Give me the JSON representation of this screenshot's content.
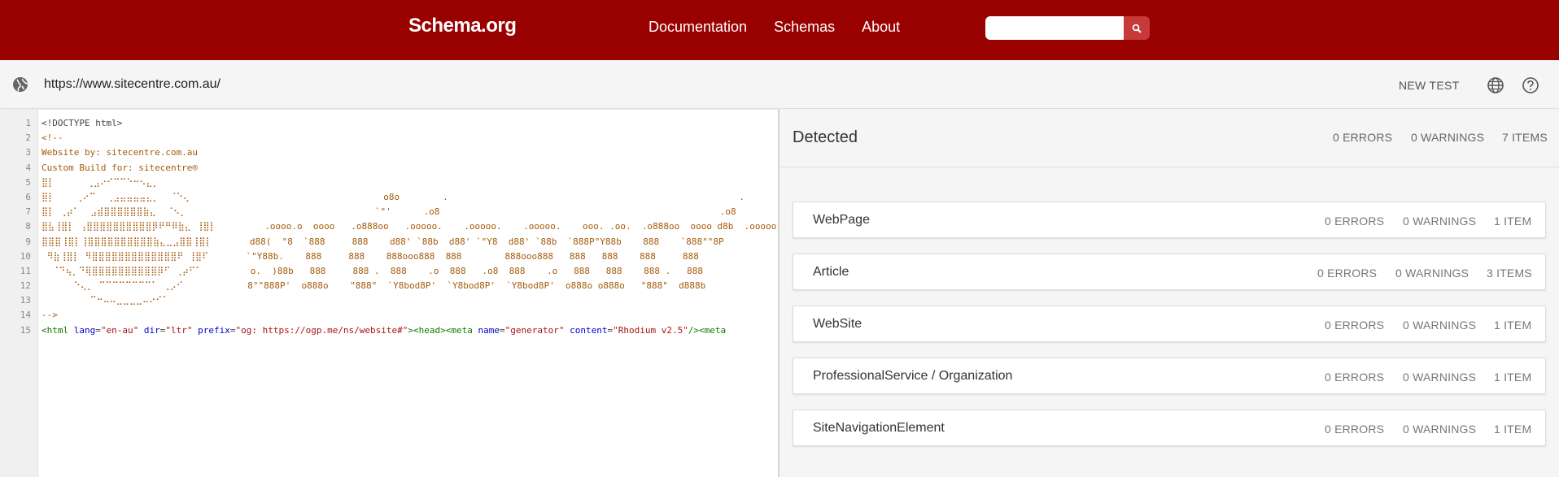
{
  "header": {
    "logo": "Schema.org",
    "nav": [
      "Documentation",
      "Schemas",
      "About"
    ],
    "search_placeholder": ""
  },
  "urlbar": {
    "url": "https://www.sitecentre.com.au/",
    "new_test": "NEW TEST"
  },
  "code": {
    "line_numbers": [
      "1",
      "2",
      "3",
      "4",
      "5",
      "6",
      "7",
      "8",
      "9",
      "10",
      "11",
      "12",
      "13",
      "14",
      "15"
    ],
    "lines": [
      "<!DOCTYPE html>",
      "<!--",
      "Website by: sitecentre.com.au",
      "Custom Build for: sitecentre®",
      "⣿⡇      ⢀⣠⠔⠊⠉⠉⠑⠒⠢⣄⡀",
      "⣿⡇    ⢀⠔⠉  ⢀⣠⣤⣤⣤⣤⣄⡀  ⠈⠑⢄                                    o8o        .                                                      .",
      "⣿⡇ ⢀⡴⠁  ⣠⣾⣿⣿⣿⣿⣿⣿⣷⣄  ⠈⠢⡀                                   `\"'      .o8                                                    .o8",
      "⣿⣧⢸⣿⡇ ⢠⣿⣿⣿⣿⣿⣿⣿⣿⣿⣿⡿⠟⠛⠿⣷⣄ ⢸⣿⡇         .oooo.o  oooo   .o888oo   .ooooo.    .ooooo.    .ooooo.    ooo. .oo.  .o888oo  oooo d8b  .ooooo.",
      "⣿⣿⣿⢸⣿⡇⢸⣿⣿⣿⣿⣿⣿⣿⣿⣿⣿⣷⣄⣀⣠⣿⣿⢸⣿⡇       d88(  \"8  `888     888    d88' `88b  d88' `\"Y8  d88' `88b  `888P\"Y88b    888    `888\"\"8P",
      " ⠻⣷⢸⣿⡇ ⠻⣿⣿⣿⣿⣿⣿⣿⣿⣿⣿⣿⣿⣿⠟ ⢸⣿⠏       `\"Y88b.    888     888    888ooo888  888        888ooo888   888   888    888     888",
      "  ⠈⠙⢦⡀⠙⢿⣿⣿⣿⣿⣿⣿⣿⣿⣿⣿⡿⠋ ⢀⡴⠋⠁         o.  )88b   888     888 .  888    .o  888   .o8  888    .o   888   888    888 .   888",
      "      ⠑⢄⡀ ⠉⠉⠉⠉⠉⠉⠉⠉⠁ ⢀⡠⠊            8\"\"888P'  o888o    \"888\"  `Y8bod8P'  `Y8bod8P'  `Y8bod8P'  o888o o888o   \"888\"  d888b",
      "         ⠉⠒⠤⠤⣀⣀⣀⣀⠤⠔⠊⠁",
      "-->",
      "<html lang=\"en-au\" dir=\"ltr\" prefix=\"og: https://ogp.me/ns/website#\"><head><meta name=\"generator\" content=\"Rhodium v2.5\"/><meta"
    ],
    "line15_parts": {
      "t1": "<html ",
      "a1": "lang",
      "e1": "=",
      "s1": "\"en-au\"",
      "sp1": " ",
      "a2": "dir",
      "e2": "=",
      "s2": "\"ltr\"",
      "sp2": " ",
      "a3": "prefix",
      "e3": "=",
      "s3": "\"og: https://ogp.me/ns/website#\"",
      "t2": "><head><meta ",
      "a4": "name",
      "e4": "=",
      "s4": "\"generator\"",
      "sp4": " ",
      "a5": "content",
      "e5": "=",
      "s5": "\"Rhodium v2.5\"",
      "t3": "/><meta"
    }
  },
  "results": {
    "title": "Detected",
    "summary": {
      "errors": "0 ERRORS",
      "warnings": "0 WARNINGS",
      "items": "7 ITEMS"
    },
    "cards": [
      {
        "label": "WebPage",
        "errors": "0 ERRORS",
        "warnings": "0 WARNINGS",
        "items": "1 ITEM"
      },
      {
        "label": "Article",
        "errors": "0 ERRORS",
        "warnings": "0 WARNINGS",
        "items": "3 ITEMS"
      },
      {
        "label": "WebSite",
        "errors": "0 ERRORS",
        "warnings": "0 WARNINGS",
        "items": "1 ITEM"
      },
      {
        "label": "ProfessionalService / Organization",
        "errors": "0 ERRORS",
        "warnings": "0 WARNINGS",
        "items": "1 ITEM"
      },
      {
        "label": "SiteNavigationElement",
        "errors": "0 ERRORS",
        "warnings": "0 WARNINGS",
        "items": "1 ITEM"
      }
    ]
  },
  "icons": {
    "search": "search-icon",
    "globe": "globe-icon",
    "help": "help-icon"
  },
  "colors": {
    "brand": "#990000",
    "search_button": "#c83a3a",
    "comment": "#a55a0a"
  }
}
